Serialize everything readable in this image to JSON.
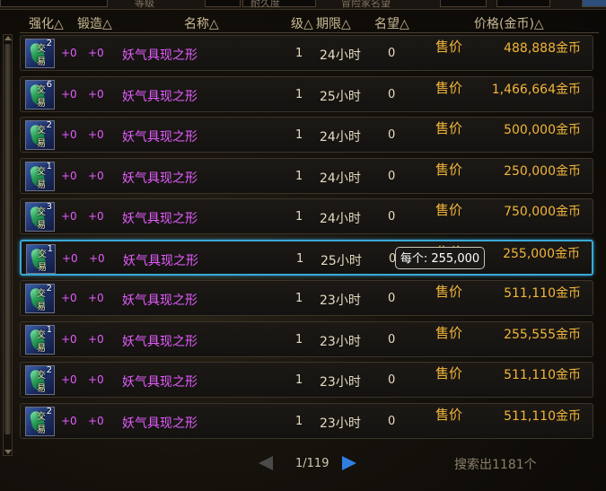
{
  "top_strip": {
    "labels": [
      "等级",
      "耐久度",
      "冒险家名望"
    ]
  },
  "columns": {
    "enhance": "强化△",
    "forge": "锻造△",
    "name": "名称△",
    "level": "级△",
    "duration": "期限△",
    "fame": "名望△",
    "price": "价格(金币)△"
  },
  "rows": [
    {
      "qty": "2",
      "trade": "交易",
      "enhance": "+0",
      "forge": "+0",
      "name": "妖气具现之形",
      "level": "1",
      "duration": "24小时",
      "fame": "0",
      "sell_label": "售价",
      "price": "488,888金币"
    },
    {
      "qty": "6",
      "trade": "交易",
      "enhance": "+0",
      "forge": "+0",
      "name": "妖气具现之形",
      "level": "1",
      "duration": "25小时",
      "fame": "0",
      "sell_label": "售价",
      "price": "1,466,664金币"
    },
    {
      "qty": "2",
      "trade": "交易",
      "enhance": "+0",
      "forge": "+0",
      "name": "妖气具现之形",
      "level": "1",
      "duration": "24小时",
      "fame": "0",
      "sell_label": "售价",
      "price": "500,000金币"
    },
    {
      "qty": "1",
      "trade": "交易",
      "enhance": "+0",
      "forge": "+0",
      "name": "妖气具现之形",
      "level": "1",
      "duration": "24小时",
      "fame": "0",
      "sell_label": "售价",
      "price": "250,000金币"
    },
    {
      "qty": "3",
      "trade": "交易",
      "enhance": "+0",
      "forge": "+0",
      "name": "妖气具现之形",
      "level": "1",
      "duration": "24小时",
      "fame": "0",
      "sell_label": "售价",
      "price": "750,000金币"
    },
    {
      "qty": "1",
      "trade": "交易",
      "enhance": "+0",
      "forge": "+0",
      "name": "妖气具现之形",
      "level": "1",
      "duration": "25小时",
      "fame": "0",
      "sell_label": "售价",
      "price": "255,000金币"
    },
    {
      "qty": "2",
      "trade": "交易",
      "enhance": "+0",
      "forge": "+0",
      "name": "妖气具现之形",
      "level": "1",
      "duration": "23小时",
      "fame": "0",
      "sell_label": "售价",
      "price": "511,110金币"
    },
    {
      "qty": "1",
      "trade": "交易",
      "enhance": "+0",
      "forge": "+0",
      "name": "妖气具现之形",
      "level": "1",
      "duration": "23小时",
      "fame": "0",
      "sell_label": "售价",
      "price": "255,555金币"
    },
    {
      "qty": "2",
      "trade": "交易",
      "enhance": "+0",
      "forge": "+0",
      "name": "妖气具现之形",
      "level": "1",
      "duration": "23小时",
      "fame": "0",
      "sell_label": "售价",
      "price": "511,110金币"
    },
    {
      "qty": "2",
      "trade": "交易",
      "enhance": "+0",
      "forge": "+0",
      "name": "妖气具现之形",
      "level": "1",
      "duration": "23小时",
      "fame": "0",
      "sell_label": "售价",
      "price": "511,110金币"
    }
  ],
  "selected_row": 5,
  "tooltip": "每个: 255,000",
  "pager": {
    "text": "1/119"
  },
  "result_count": "搜索出1181个",
  "colors": {
    "item_name": "#e45cff",
    "price": "#f2b63a",
    "selected_border": "#3aa9d6",
    "next_arrow": "#2f7fe0"
  }
}
